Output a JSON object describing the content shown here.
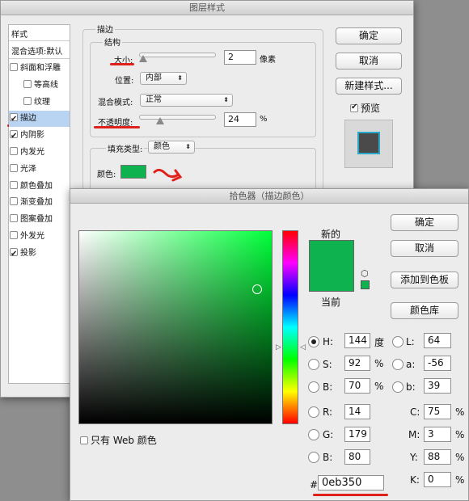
{
  "layer_style": {
    "title": "图层样式",
    "styles_header": "样式",
    "blend_default": "混合选项:默认",
    "style_items": [
      {
        "label": "斜面和浮雕",
        "checked": false,
        "sub": false
      },
      {
        "label": "等高线",
        "checked": false,
        "sub": true
      },
      {
        "label": "纹理",
        "checked": false,
        "sub": true
      },
      {
        "label": "描边",
        "checked": true,
        "sub": false,
        "selected": true
      },
      {
        "label": "内阴影",
        "checked": true,
        "sub": false
      },
      {
        "label": "内发光",
        "checked": false,
        "sub": false
      },
      {
        "label": "光泽",
        "checked": false,
        "sub": false
      },
      {
        "label": "颜色叠加",
        "checked": false,
        "sub": false
      },
      {
        "label": "渐变叠加",
        "checked": false,
        "sub": false
      },
      {
        "label": "图案叠加",
        "checked": false,
        "sub": false
      },
      {
        "label": "外发光",
        "checked": false,
        "sub": false
      },
      {
        "label": "投影",
        "checked": true,
        "sub": false
      }
    ],
    "stroke_group": "描边",
    "structure_group": "结构",
    "size_label": "大小:",
    "size_value": "2",
    "size_unit": "像素",
    "position_label": "位置:",
    "position_value": "内部",
    "blend_mode_label": "混合模式:",
    "blend_mode_value": "正常",
    "opacity_label": "不透明度:",
    "opacity_value": "24",
    "opacity_unit": "%",
    "fill_type_label": "填充类型:",
    "fill_type_value": "颜色",
    "color_label": "颜色:",
    "stroke_color": "#0eb350",
    "ok_button": "确定",
    "cancel_button": "取消",
    "new_style_button": "新建样式...",
    "preview_label": "预览",
    "preview_checked": true
  },
  "color_picker": {
    "title": "拾色器（描边颜色）",
    "new_label": "新的",
    "current_label": "当前",
    "new_color": "#0eb350",
    "current_color": "#0eb350",
    "hue_color": "#00ff3a",
    "ok_button": "确定",
    "cancel_button": "取消",
    "add_swatch_button": "添加到色板",
    "libraries_button": "颜色库",
    "web_only_label": "只有 Web 颜色",
    "H": {
      "label": "H:",
      "value": "144",
      "unit": "度"
    },
    "S": {
      "label": "S:",
      "value": "92",
      "unit": "%"
    },
    "Bv": {
      "label": "B:",
      "value": "70",
      "unit": "%"
    },
    "R": {
      "label": "R:",
      "value": "14"
    },
    "G": {
      "label": "G:",
      "value": "179"
    },
    "Bb": {
      "label": "B:",
      "value": "80"
    },
    "L": {
      "label": "L:",
      "value": "64"
    },
    "a": {
      "label": "a:",
      "value": "-56"
    },
    "b": {
      "label": "b:",
      "value": "39"
    },
    "C": {
      "label": "C:",
      "value": "75",
      "unit": "%"
    },
    "M": {
      "label": "M:",
      "value": "3",
      "unit": "%"
    },
    "Y": {
      "label": "Y:",
      "value": "88",
      "unit": "%"
    },
    "K": {
      "label": "K:",
      "value": "0",
      "unit": "%"
    },
    "hex_label": "#",
    "hex_value": "0eb350"
  },
  "annotation_color": "#e0201a"
}
